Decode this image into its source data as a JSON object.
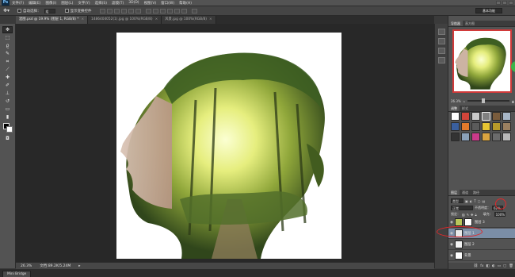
{
  "menubar": {
    "logo": "Ps",
    "items": [
      "文件(F)",
      "编辑(E)",
      "图像(I)",
      "图层(L)",
      "文字(Y)",
      "选择(S)",
      "滤镜(T)",
      "3D(D)",
      "视图(V)",
      "窗口(W)",
      "帮助(H)"
    ]
  },
  "options": {
    "auto_select_label": "自动选择：",
    "auto_select_value": "组",
    "transform_label": "显示变换控件"
  },
  "workspace_button": "基本功能",
  "tabs": [
    {
      "label": "混图.psd @ 19.9% (图层 1, RGB/8) *",
      "active": true
    },
    {
      "label": "1486404052(1).jpg @ 100%(RGB/8)",
      "active": false
    },
    {
      "label": "风景.jpg @ 100%(RGB/8)",
      "active": false
    }
  ],
  "status": {
    "zoom": "26.3%",
    "doc": "文档:89.2K/5.24M"
  },
  "bottom_tab": "Mini Bridge",
  "navigator": {
    "tabs": [
      "导航器",
      "直方图"
    ],
    "zoom": "26.3%"
  },
  "adjust_panel": {
    "tabs": [
      "调整",
      "样式"
    ]
  },
  "layers_panel": {
    "tabs": [
      "图层",
      "通道",
      "路径"
    ],
    "kind_label": "类型",
    "blend_mode": "正常",
    "opacity_label": "不透明度：",
    "opacity_value": "62%",
    "lock_label": "锁定：",
    "fill_label": "填充：",
    "fill_value": "100%",
    "layers": [
      {
        "name": "图层 3",
        "visible": true,
        "active": false
      },
      {
        "name": "图层 1",
        "visible": true,
        "active": true
      },
      {
        "name": "图层 2",
        "visible": true,
        "active": false
      },
      {
        "name": "背景",
        "visible": true,
        "active": false
      }
    ]
  },
  "colors": {
    "foreground": "#000000",
    "background": "#ffffff",
    "highlight": "#e0282a",
    "active_layer": "#7b8ea7"
  }
}
